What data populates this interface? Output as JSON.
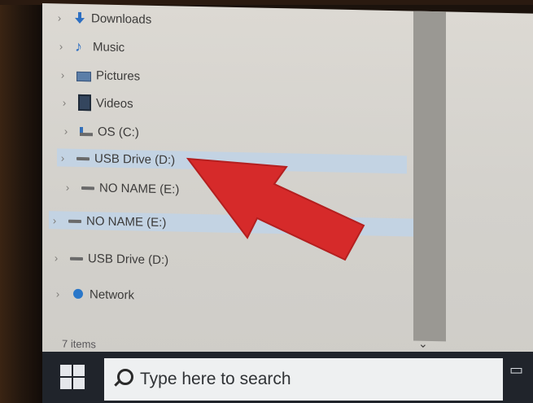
{
  "tree": {
    "items": [
      {
        "label": "Downloads",
        "icon": "download-icon"
      },
      {
        "label": "Music",
        "icon": "music-icon"
      },
      {
        "label": "Pictures",
        "icon": "pictures-icon"
      },
      {
        "label": "Videos",
        "icon": "videos-icon"
      },
      {
        "label": "OS (C:)",
        "icon": "os-drive-icon"
      },
      {
        "label": "USB Drive (D:)",
        "icon": "usb-drive-icon"
      },
      {
        "label": "NO NAME (E:)",
        "icon": "drive-icon"
      },
      {
        "label": "NO NAME (E:)",
        "icon": "drive-icon"
      },
      {
        "label": "USB Drive (D:)",
        "icon": "usb-drive-icon"
      },
      {
        "label": "Network",
        "icon": "network-icon"
      }
    ]
  },
  "status": {
    "items_count": "7 items"
  },
  "taskbar": {
    "search_placeholder": "Type here to search"
  },
  "colors": {
    "selection": "#c3d3e3",
    "annotation_arrow": "#d62a2a",
    "taskbar": "#20242b"
  }
}
